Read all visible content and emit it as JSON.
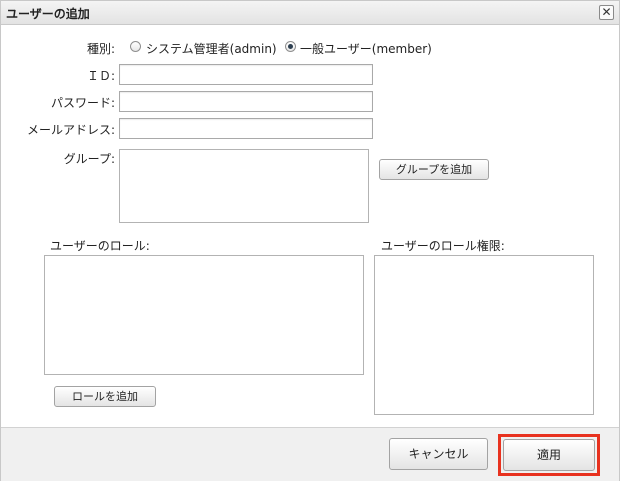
{
  "dialog": {
    "title": "ユーザーの追加",
    "close_symbol": "✕"
  },
  "form": {
    "type_label": "種別:",
    "type_options": [
      {
        "label": "システム管理者(admin)",
        "checked": false
      },
      {
        "label": "一般ユーザー(member)",
        "checked": true
      }
    ],
    "id_label": "ＩＤ:",
    "id_value": "",
    "password_label": "パスワード:",
    "password_value": "",
    "email_label": "メールアドレス:",
    "email_value": "",
    "group_label": "グループ:",
    "add_group_button": "グループを追加",
    "roles_label": "ユーザーのロール:",
    "role_permissions_label": "ユーザーのロール権限:",
    "add_role_button": "ロールを追加"
  },
  "footer": {
    "cancel_button": "キャンセル",
    "apply_button": "適用",
    "highlight_color": "#e8321f"
  }
}
